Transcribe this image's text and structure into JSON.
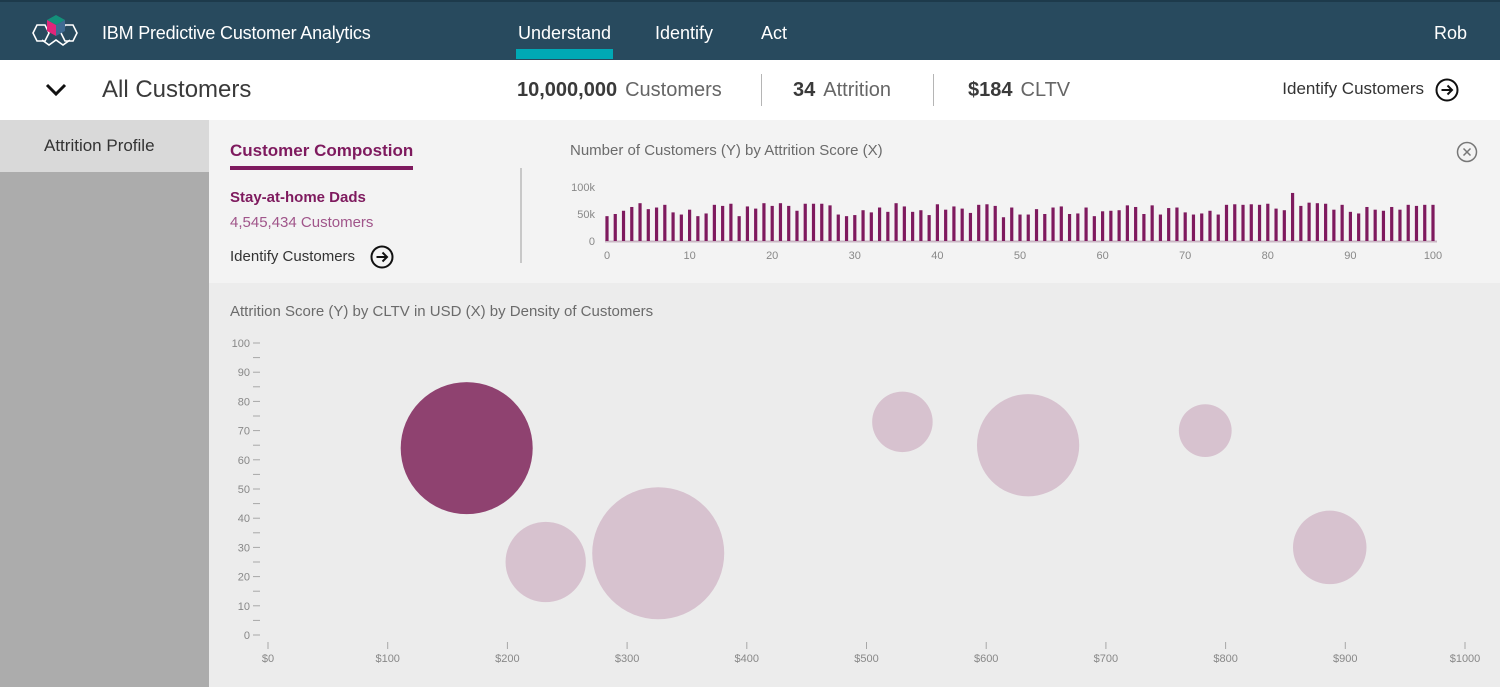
{
  "app": {
    "title": "IBM Predictive Customer Analytics",
    "nav_tabs": [
      {
        "label": "Understand",
        "active": true
      },
      {
        "label": "Identify",
        "active": false
      },
      {
        "label": "Act",
        "active": false
      }
    ],
    "user": "Rob"
  },
  "subheader": {
    "segment": "All Customers",
    "stats": [
      {
        "value": "10,000,000",
        "label": "Customers"
      },
      {
        "value": "34",
        "label": "Attrition"
      },
      {
        "value": "$184",
        "label": "CLTV"
      }
    ],
    "identify_link": "Identify Customers"
  },
  "sidebar": {
    "items": [
      {
        "label": "Attrition Profile",
        "active": true
      }
    ]
  },
  "composition": {
    "tab_label": "Customer Compostion",
    "segment_name": "Stay-at-home Dads",
    "segment_count": "4,545,434 Customers",
    "identify_link": "Identify Customers"
  },
  "colors": {
    "header_bg": "#284a5e",
    "accent_teal": "#00a9b5",
    "brand_purple": "#7e1a5e",
    "bubble_selected": "#8f4270",
    "bubble_default": "#d7c2cf"
  },
  "chart_data": [
    {
      "type": "bar",
      "title": "Number of Customers (Y) by Attrition Score (X)",
      "xlabel": "Attrition Score",
      "ylabel": "Number of Customers",
      "x_ticks": [
        "0",
        "10",
        "20",
        "30",
        "40",
        "50",
        "60",
        "70",
        "80",
        "90",
        "100"
      ],
      "y_ticks": [
        "0",
        "50k",
        "100k"
      ],
      "xlim": [
        0,
        100
      ],
      "ylim": [
        0,
        100000
      ],
      "x": [
        0,
        1,
        2,
        3,
        4,
        5,
        6,
        7,
        8,
        9,
        10,
        11,
        12,
        13,
        14,
        15,
        16,
        17,
        18,
        19,
        20,
        21,
        22,
        23,
        24,
        25,
        26,
        27,
        28,
        29,
        30,
        31,
        32,
        33,
        34,
        35,
        36,
        37,
        38,
        39,
        40,
        41,
        42,
        43,
        44,
        45,
        46,
        47,
        48,
        49,
        50,
        51,
        52,
        53,
        54,
        55,
        56,
        57,
        58,
        59,
        60,
        61,
        62,
        63,
        64,
        65,
        66,
        67,
        68,
        69,
        70,
        71,
        72,
        73,
        74,
        75,
        76,
        77,
        78,
        79,
        80,
        81,
        82,
        83,
        84,
        85,
        86,
        87,
        88,
        89,
        90,
        91,
        92,
        93,
        94,
        95,
        96,
        97,
        98,
        99,
        100
      ],
      "values": [
        46000,
        50000,
        56000,
        63000,
        70000,
        59000,
        62000,
        67000,
        53000,
        49000,
        58000,
        46000,
        51000,
        67000,
        65000,
        69000,
        46000,
        64000,
        60000,
        70000,
        65000,
        70000,
        65000,
        56000,
        69000,
        69000,
        69000,
        66000,
        49000,
        46000,
        48000,
        57000,
        53000,
        62000,
        54000,
        70000,
        64000,
        54000,
        57000,
        48000,
        68000,
        58000,
        64000,
        60000,
        52000,
        67000,
        68000,
        65000,
        44000,
        62000,
        49000,
        49000,
        59000,
        50000,
        62000,
        64000,
        50000,
        51000,
        62000,
        46000,
        55000,
        56000,
        57000,
        66000,
        63000,
        50000,
        66000,
        49000,
        61000,
        62000,
        53000,
        49000,
        51000,
        56000,
        49000,
        67000,
        68000,
        67000,
        68000,
        67000,
        69000,
        60000,
        57000,
        89000,
        65000,
        71000,
        70000,
        69000,
        58000,
        67000,
        54000,
        51000,
        63000,
        58000,
        56000,
        63000,
        58000,
        67000,
        65000,
        67000,
        67000
      ],
      "grid": false
    },
    {
      "type": "scatter",
      "subtype": "bubble",
      "title": "Attrition Score (Y) by CLTV in USD (X) by Density of Customers",
      "xlabel": "CLTV in USD",
      "ylabel": "Attrition Score",
      "x_ticks": [
        "$0",
        "$100",
        "$200",
        "$300",
        "$400",
        "$500",
        "$600",
        "$700",
        "$800",
        "$900",
        "$1000"
      ],
      "y_ticks": [
        "0",
        "10",
        "20",
        "30",
        "40",
        "50",
        "60",
        "70",
        "80",
        "90",
        "100"
      ],
      "xlim": [
        0,
        1000
      ],
      "ylim": [
        0,
        100
      ],
      "points": [
        {
          "x": 166,
          "y": 64,
          "density": 1.0,
          "selected": true
        },
        {
          "x": 232,
          "y": 25,
          "density": 0.37,
          "selected": false
        },
        {
          "x": 326,
          "y": 28,
          "density": 1.0,
          "selected": false
        },
        {
          "x": 530,
          "y": 73,
          "density": 0.21,
          "selected": false
        },
        {
          "x": 635,
          "y": 65,
          "density": 0.6,
          "selected": false
        },
        {
          "x": 783,
          "y": 70,
          "density": 0.16,
          "selected": false
        },
        {
          "x": 887,
          "y": 30,
          "density": 0.31,
          "selected": false
        }
      ],
      "grid": false
    }
  ]
}
